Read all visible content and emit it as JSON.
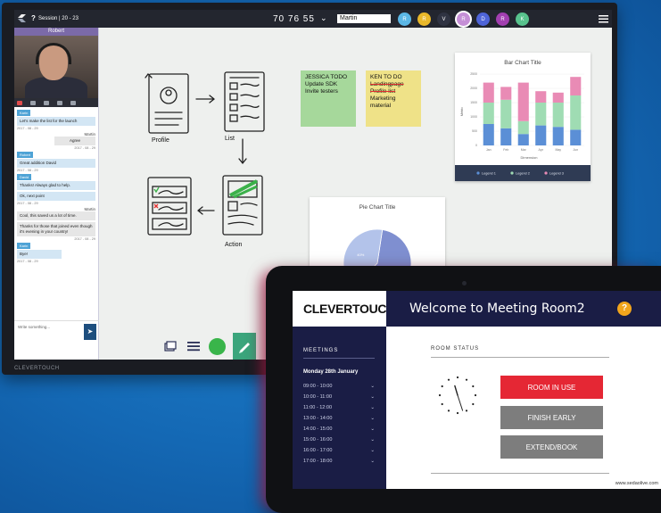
{
  "monitor": {
    "brand": "CLEVERTOUCH",
    "topbar": {
      "help": "?",
      "session": "Session | 20 - 23",
      "code": "70 76 55",
      "name_value": "Martin",
      "avatars": [
        {
          "letter": "R",
          "color": "#5bb7e6"
        },
        {
          "letter": "R",
          "color": "#e9b82a"
        },
        {
          "letter": "V",
          "color": "#2f3342"
        },
        {
          "letter": "R",
          "color": "#c58fd6"
        },
        {
          "letter": "D",
          "color": "#4e64d8"
        },
        {
          "letter": "R",
          "color": "#a23fb0"
        },
        {
          "letter": "K",
          "color": "#58c28d"
        }
      ]
    },
    "chat": {
      "camera_label": "Robert",
      "messages": [
        {
          "tag": "Karin",
          "text": "Let's make the list for the launch",
          "time": "2017 - 08 - 29",
          "side": "left"
        },
        {
          "who": "Martin",
          "text": "Agree",
          "time": "2017 - 08 - 29",
          "side": "right"
        },
        {
          "tag": "Robert",
          "text": "Great addition David",
          "time": "2017 - 08 - 29",
          "side": "left"
        },
        {
          "tag": "David",
          "text": "Thanks! Always glad to help.",
          "side": "left"
        },
        {
          "text": "Ok, next point",
          "time": "2017 - 08 - 29",
          "side": "left"
        },
        {
          "who": "Martin",
          "text": "Cool, this saved us a lot of time.",
          "side": "left-grey"
        },
        {
          "text": "Thanks for those that joined even though it's evening in your country!",
          "time": "2017 - 08 - 29",
          "side": "left-grey"
        },
        {
          "tag": "Karin",
          "text": "Bye!",
          "time": "2017 - 08 - 29",
          "side": "left"
        }
      ],
      "input_placeholder": "Write something..."
    },
    "board": {
      "sketch_labels": [
        "Profile",
        "List",
        "Action"
      ],
      "sticky_green": {
        "title": "JESSICA TODO",
        "lines": [
          "Update SDK",
          "Invite testers"
        ]
      },
      "sticky_yellow": {
        "title": "KEN TO DO",
        "lines": [
          "Landingpage",
          "Profile list",
          "Marketing material"
        ]
      }
    }
  },
  "chart_data": [
    {
      "type": "bar",
      "title": "Bar Chart Title",
      "xlabel": "Dimension",
      "ylabel": "Metric",
      "categories": [
        "Jan",
        "Feb",
        "Mar",
        "Apr",
        "May",
        "Jun"
      ],
      "y_ticks": [
        "0",
        "500",
        "1000",
        "1500",
        "2000",
        "2500"
      ],
      "ylim": [
        0,
        2500
      ],
      "stacked": true,
      "series": [
        {
          "name": "Legend 1",
          "color": "#5b8fd6",
          "values": [
            750,
            600,
            400,
            700,
            650,
            550
          ]
        },
        {
          "name": "Legend 2",
          "color": "#9fdcb3",
          "values": [
            750,
            1000,
            450,
            800,
            850,
            1200
          ]
        },
        {
          "name": "Legend 3",
          "color": "#e98bb5",
          "values": [
            700,
            450,
            1350,
            400,
            350,
            650
          ]
        }
      ],
      "legend_position": "bottom"
    },
    {
      "type": "pie",
      "title": "Pie Chart Title",
      "slices": [
        {
          "label": "",
          "value": 60,
          "color": "#7f8fd0",
          "data_label": "60%"
        },
        {
          "label": "",
          "value": 40,
          "color": "#b3c3ea",
          "data_label": "40%"
        }
      ]
    }
  ],
  "tablet": {
    "brand": "CLEVERTOUCH",
    "brand_mark": "®",
    "welcome": "Welcome to Meeting Room2",
    "help": "?",
    "meetings_title": "MEETINGS",
    "day": "Monday 28th January",
    "slots": [
      "09:00 - 10:00",
      "10:00 - 11:00",
      "11:00 - 12:00",
      "13:00 - 14:00",
      "14:00 - 15:00",
      "15:00 - 16:00",
      "16:00 - 17:00",
      "17:00 - 18:00"
    ],
    "room_status": "ROOM STATUS",
    "btn_in_use": "ROOM IN USE",
    "btn_finish": "FINISH EARLY",
    "btn_extend": "EXTEND/BOOK",
    "url": "www.sedaolive.com",
    "clock": {
      "hour": 11,
      "minute": 27
    }
  }
}
